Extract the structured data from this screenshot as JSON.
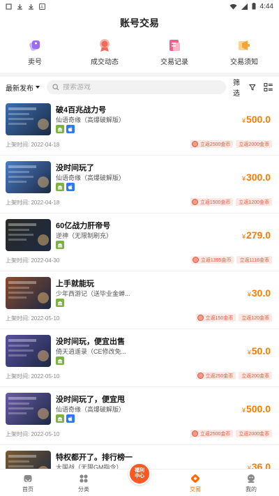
{
  "status_bar": {
    "time": "4:44"
  },
  "header": {
    "title": "账号交易"
  },
  "top_menu": [
    {
      "label": "卖号",
      "icon": "sell-icon",
      "color": "#9b6bf0"
    },
    {
      "label": "成交动态",
      "icon": "deal-dynamics-icon",
      "color": "#ef6b57"
    },
    {
      "label": "交易记录",
      "icon": "trade-record-icon",
      "color": "#f25f8a"
    },
    {
      "label": "交易须知",
      "icon": "trade-notice-icon",
      "color": "#f7a23a"
    }
  ],
  "filter": {
    "sort_label": "最新发布",
    "search_placeholder": "搜索游戏",
    "filter_label": "筛选"
  },
  "listings": [
    {
      "name": "破4百兆战力号",
      "game": "仙语奇缘（高爆破解版）",
      "platforms": [
        "android",
        "ios"
      ],
      "price": "500.0",
      "date": "上架时间: 2022-04-18",
      "rebate1": "立返2500金币",
      "rebate2": "立返2000金币",
      "thumb_color": "#3a6fb0"
    },
    {
      "name": "没时间玩了",
      "game": "仙语奇缘（高爆破解版）",
      "platforms": [
        "android",
        "ios"
      ],
      "price": "300.0",
      "date": "上架时间: 2022-04-18",
      "rebate1": "立返1500金币",
      "rebate2": "立返1200金币",
      "thumb_color": "#4a7cc8"
    },
    {
      "name": "60亿战力肝帝号",
      "game": "逆神（无限制刷充）",
      "platforms": [
        "android"
      ],
      "price": "279.0",
      "date": "上架时间: 2022-04-30",
      "rebate1": "立返1395金币",
      "rebate2": "立返1116金币",
      "thumb_color": "#2b2b24"
    },
    {
      "name": "上手就能玩",
      "game": "少年西游记（送毕业金蝉...",
      "platforms": [
        "android"
      ],
      "price": "30.0",
      "date": "上架时间: 2022-05-10",
      "rebate1": "立返150金币",
      "rebate2": "立返120金币",
      "thumb_color": "#8a4a2a"
    },
    {
      "name": "没时间玩，便宜出售",
      "game": "倚天逍遥录（CE修改免...",
      "platforms": [
        "android"
      ],
      "price": "50.0",
      "date": "上架时间: 2022-05-10",
      "rebate1": "立返250金币",
      "rebate2": "立返200金币",
      "thumb_color": "#5a4fa0"
    },
    {
      "name": "没时间玩了，便宜甩",
      "game": "仙语奇缘（高爆破解版）",
      "platforms": [
        "android",
        "ios"
      ],
      "price": "500.0",
      "date": "上架时间: 2022-05-10",
      "rebate1": "立返2500金币",
      "rebate2": "立返2000金币",
      "thumb_color": "#6a5aa8"
    },
    {
      "name": "特权都开了。排行榜一",
      "game": "大国战（无限GM指令）",
      "platforms": [
        "android"
      ],
      "price": "36.0",
      "date": "",
      "rebate1": "",
      "rebate2": "",
      "thumb_color": "#7a5a30"
    }
  ],
  "price_currency": "¥",
  "tabbar": [
    {
      "label": "首页",
      "icon": "home-icon"
    },
    {
      "label": "分类",
      "icon": "category-icon"
    },
    {
      "label": "",
      "icon": "center-welfare-icon",
      "center_text": "福利中心"
    },
    {
      "label": "交易",
      "icon": "trade-icon"
    },
    {
      "label": "我的",
      "icon": "profile-icon"
    }
  ],
  "colors": {
    "accent": "#ff6a00",
    "price": "#ff7a00",
    "rebate_text": "#e0573d",
    "rebate_bg": "#fde8e4"
  }
}
